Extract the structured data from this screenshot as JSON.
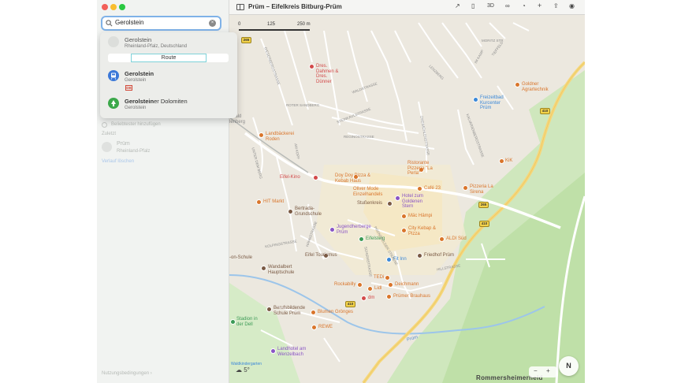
{
  "window": {
    "title": "Prüm – Eifelkreis Bitburg-Prüm"
  },
  "toolbar": {
    "icons": [
      "sidebar-icon",
      "direction-icon",
      "map-icon",
      "3d-label",
      "binoculars-icon",
      "look-around-icon",
      "add-icon",
      "share-icon",
      "account-icon"
    ],
    "label_3d": "3D",
    "glyph_direction": "↗",
    "glyph_map": "▯",
    "glyph_binoculars": "∞",
    "glyph_look": "◔",
    "glyph_add": "+",
    "glyph_share": "⇪",
    "glyph_account": "◉"
  },
  "search": {
    "value": "Gerolstein",
    "clear_glyph": "×"
  },
  "suggestions": [
    {
      "title": "Gerolstein",
      "subtitle": "Rheinland-Pfalz, Deutschland"
    },
    {
      "title": "Gerolstein",
      "subtitle": "Gerolstein",
      "badge": "DB"
    },
    {
      "title_match": "Gerolstein",
      "title_rest": "er Dolomiten",
      "subtitle": "Gerolstein"
    }
  ],
  "route_label": "Route",
  "sidebar_dim": {
    "favorites_add": "Beliebtester hinzufügen",
    "recent_header": "Zuletzt",
    "recent_place": "Prüm",
    "recent_place_sub": "Rheinland-Pfalz",
    "clear_history": "Verlauf löschen",
    "terms": "Nutzungsbedingungen ›"
  },
  "map": {
    "scale": {
      "zero": "0",
      "mid": "125",
      "end": "250 m"
    },
    "weather": "☁ 5°",
    "region_label": "Rommersheimerheld",
    "zoom_minus": "−",
    "zoom_plus": "+",
    "compass": "N",
    "shields": [
      "265",
      "410",
      "265",
      "410",
      "410"
    ],
    "pois": [
      {
        "text": "Dres. Dahmen & Dres. Dünner",
        "cls": "poi-r"
      },
      {
        "text": "Goldner Agrartechnik",
        "cls": "poi-o"
      },
      {
        "text": "Freizeitbad Kurcenter Prüm",
        "cls": "poi-b"
      },
      {
        "text": "Landbäckerei Roden",
        "cls": "poi-o"
      },
      {
        "text": "Ristorante Pizzeria \"La Perla\"",
        "cls": "poi-o"
      },
      {
        "text": "KiK",
        "cls": "poi-o"
      },
      {
        "text": "Eifel-Kino",
        "cls": "poi-r"
      },
      {
        "text": "Doy Doy Pizza & Kebab Haus",
        "cls": "poi-o"
      },
      {
        "text": "Café 23",
        "cls": "poi-o"
      },
      {
        "text": "Pizzeria La Sirena",
        "cls": "poi-o"
      },
      {
        "text": "Oliver Mode Einzelhandels",
        "cls": "poi-o"
      },
      {
        "text": "Hotel zum Goldenen Stern",
        "cls": "poi-p"
      },
      {
        "text": "HIT Markt",
        "cls": "poi-o"
      },
      {
        "text": "Stußenkreis",
        "cls": "poi-br"
      },
      {
        "text": "Bertrada-Grundschule",
        "cls": "poi-br"
      },
      {
        "text": "Mäc Hämpi",
        "cls": "poi-o"
      },
      {
        "text": "City Kebap & Pizza",
        "cls": "poi-o"
      },
      {
        "text": "Jugendherberge Prüm",
        "cls": "poi-p"
      },
      {
        "text": "ALDI Süd",
        "cls": "poi-o"
      },
      {
        "text": "Eifelsteig",
        "cls": "poi-g"
      },
      {
        "text": "Eifel Tourismus",
        "cls": "poi-br"
      },
      {
        "text": "Fit Inn",
        "cls": "poi-b"
      },
      {
        "text": "Friedhof Prüm",
        "cls": "poi-br"
      },
      {
        "text": "Wandalbert Hauptschule",
        "cls": "poi-br"
      },
      {
        "text": "TEDi",
        "cls": "poi-o"
      },
      {
        "text": "Deichmann",
        "cls": "poi-o"
      },
      {
        "text": "Rockabilly",
        "cls": "poi-o"
      },
      {
        "text": "Lidl",
        "cls": "poi-o"
      },
      {
        "text": "dm",
        "cls": "poi-r"
      },
      {
        "text": "Prümer Brauhaus",
        "cls": "poi-o"
      },
      {
        "text": "Berufsbildende Schule Prüm",
        "cls": "poi-br"
      },
      {
        "text": "Blumen Grönges",
        "cls": "poi-o"
      },
      {
        "text": "Stadion in der Dell",
        "cls": "poi-g"
      },
      {
        "text": "REWE",
        "cls": "poi-o"
      },
      {
        "text": "Landhotel am Wenzelbach",
        "cls": "poi-p"
      },
      {
        "text": "Waldkindergarten",
        "cls": "poi-b"
      },
      {
        "text": "-on-Schule",
        "cls": "poi-br"
      },
      {
        "text": "swald",
        "cls": "street"
      },
      {
        "text": "lenberg",
        "cls": "street"
      }
    ],
    "streets": [
      "GIESERBERGSTRASSE",
      "WALDSTRASSE",
      "LENZBERG",
      "ROTER SANDBERG",
      "STEINKAULSTRASSE",
      "REGINOSTRASSE",
      "DREIMÜHLENSTRASSE",
      "KALVARIENBERGSTRASSE",
      "UNTER DEM BERG",
      "AM KOPF",
      "KOLPINGSTRASSE",
      "HAHNSTRASSE",
      "SCHIRMSTRASSE",
      "PRONSFELDER STRASSE",
      "HILLSTRASSE",
      "IM KAMP",
      "TIEFFELD",
      "Prüm",
      "MORITZ STR"
    ],
    "colors": {
      "green": "#cfe7bd",
      "green_dark": "#bfe0a8",
      "water": "#9cc5ea",
      "road": "#ffffff",
      "highway": "#f6d77b",
      "town": "#f6ecd0"
    }
  }
}
